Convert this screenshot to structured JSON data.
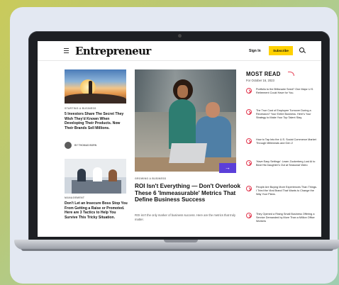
{
  "site": {
    "logo": "Entrepreneur",
    "sign_in_label": "Sign In",
    "subscribe_label": "Subscribe"
  },
  "left_column": {
    "story1": {
      "kicker": "STARTING A BUSINESS",
      "title": "5 Investors Share The Secret They Wish They'd Known When Developing Their Products. Now Their Brands Sell Millions.",
      "byline": "BY THOMAS BORN"
    },
    "story2": {
      "kicker": "MANAGEMENT",
      "title": "Don't Let an Insecure Boss Stop You From Getting a Raise or Promoted. Here are 3 Tactics to Help You Survive This Tricky Situation."
    }
  },
  "hero": {
    "kicker": "GROWING A BUSINESS",
    "title": "ROI Isn't Everything — Don't Overlook These 6 'Immeasurable' Metrics That Define Business Success",
    "dek": "ROI isn't the only marker of business success. Here are the metrics that truly matter."
  },
  "most_read": {
    "title": "MOST READ",
    "date": "For October 16, 2023",
    "items": [
      "Portfolio to the Billionaire Seed? One Major U.S. Retirement Could Have for You.",
      "The True Cost of Employee Turnover During a Recession? Your Entire Business. Here's Your Strategy to Make Your Top Talent Stay.",
      "How to Tap Into the U.S. Social Commerce Market Through Millennials and Gen Z",
      "'Have Easy Settings': Learn Zuckerberg Lost Ai to Beat His Daughter's Out at Seasonal Video",
      "People Are Buying More Experiences Than Things. I Tried the Viral Brand That Wants to Change the Way Your Plans.",
      "They Opened a Rising Small Business Offering a Service Demanded by More Than a Million Office Workers"
    ]
  }
}
